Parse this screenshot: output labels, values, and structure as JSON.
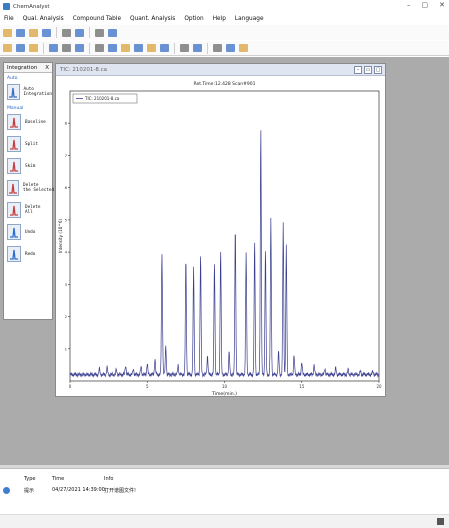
{
  "window": {
    "title": "ChemAnalyst",
    "min": "–",
    "max": "▢",
    "close": "✕"
  },
  "menu": [
    "File",
    "Qual. Analysis",
    "Compound Table",
    "Quant. Analysis",
    "Option",
    "Help",
    "Language"
  ],
  "toolbar1": [
    "open-folder-icon",
    "save-icon",
    "folder-icon",
    "open-icon",
    "compare-icon",
    "calculator-icon",
    "zoom-icon",
    "undo-icon"
  ],
  "toolbar2": [
    "layout-1-icon",
    "layout-2-icon",
    "layout-3-icon",
    "chart-1-icon",
    "chart-2-icon",
    "library-icon",
    "tic-icon",
    "bic-icon",
    "tic-nonlinear-icon",
    "spectrum-icon",
    "spectrum-icon-2",
    "mass-icon",
    "table-icon",
    "table-icon-2",
    "peak-icon",
    "peak-icon-2",
    "export-icon"
  ],
  "integration_panel": {
    "title": "Integration",
    "close": "X",
    "auto_label": "Auto",
    "manual_label": "Manual",
    "tools": [
      {
        "name": "auto-integration",
        "label": "Auto\nIntegration",
        "color": "#3a6fc4"
      },
      {
        "name": "baseline",
        "label": "Baseline",
        "color": "#c44040"
      },
      {
        "name": "split",
        "label": "Split",
        "color": "#c44040"
      },
      {
        "name": "skim",
        "label": "Skim",
        "color": "#c44040"
      },
      {
        "name": "delete-selected",
        "label": "Delete\nthe Selected",
        "color": "#c44040"
      },
      {
        "name": "delete-all",
        "label": "Delete\nAll",
        "color": "#c44040"
      },
      {
        "name": "undo",
        "label": "Undo",
        "color": "#2a6fd0"
      },
      {
        "name": "redo",
        "label": "Redo",
        "color": "#2a6fd0"
      }
    ]
  },
  "chart_window": {
    "title": "TIC: 210201-8.ca"
  },
  "chart_data": {
    "type": "line",
    "title": "Ret.Time:12.428  Scan#901",
    "xlabel": "Time(min.)",
    "ylabel": "Intensity (10^6)",
    "xlim": [
      0,
      20
    ],
    "ylim": [
      0,
      9
    ],
    "xticks": [
      0,
      5,
      10,
      15,
      20
    ],
    "yticks": [
      1,
      2,
      3,
      4,
      5,
      6,
      7,
      8
    ],
    "legend": "TIC: 210201-8.ca",
    "legend_position": "top-left",
    "series_color": "#3b3f8f",
    "baseline": 0.2,
    "peaks": [
      [
        1.9,
        0.38
      ],
      [
        2.4,
        0.42
      ],
      [
        3.0,
        0.35
      ],
      [
        3.6,
        0.5
      ],
      [
        4.1,
        0.38
      ],
      [
        4.6,
        0.45
      ],
      [
        5.0,
        0.55
      ],
      [
        5.5,
        0.7
      ],
      [
        6.0,
        0.5
      ],
      [
        6.2,
        1.1
      ],
      [
        5.95,
        3.9
      ],
      [
        7.0,
        0.5
      ],
      [
        7.5,
        3.8
      ],
      [
        8.0,
        3.5
      ],
      [
        8.45,
        3.95
      ],
      [
        8.9,
        0.8
      ],
      [
        9.35,
        3.7
      ],
      [
        9.75,
        4.1
      ],
      [
        10.3,
        0.9
      ],
      [
        10.7,
        4.8
      ],
      [
        11.4,
        4.0
      ],
      [
        11.95,
        4.35
      ],
      [
        12.35,
        7.9
      ],
      [
        12.65,
        4.1
      ],
      [
        13.0,
        5.0
      ],
      [
        13.5,
        0.9
      ],
      [
        13.8,
        4.9
      ],
      [
        14.0,
        4.2
      ],
      [
        14.5,
        0.8
      ],
      [
        15.0,
        0.6
      ],
      [
        15.8,
        0.5
      ],
      [
        16.5,
        0.4
      ],
      [
        17.2,
        0.4
      ],
      [
        18.0,
        0.35
      ],
      [
        18.8,
        0.3
      ],
      [
        19.6,
        0.3
      ]
    ]
  },
  "log": {
    "headers": {
      "type": "Type",
      "time": "Time",
      "info": "Info"
    },
    "rows": [
      {
        "type": "提示",
        "time": "04/27/2021 14:39:00",
        "info": "打开谱图文件!"
      }
    ]
  }
}
